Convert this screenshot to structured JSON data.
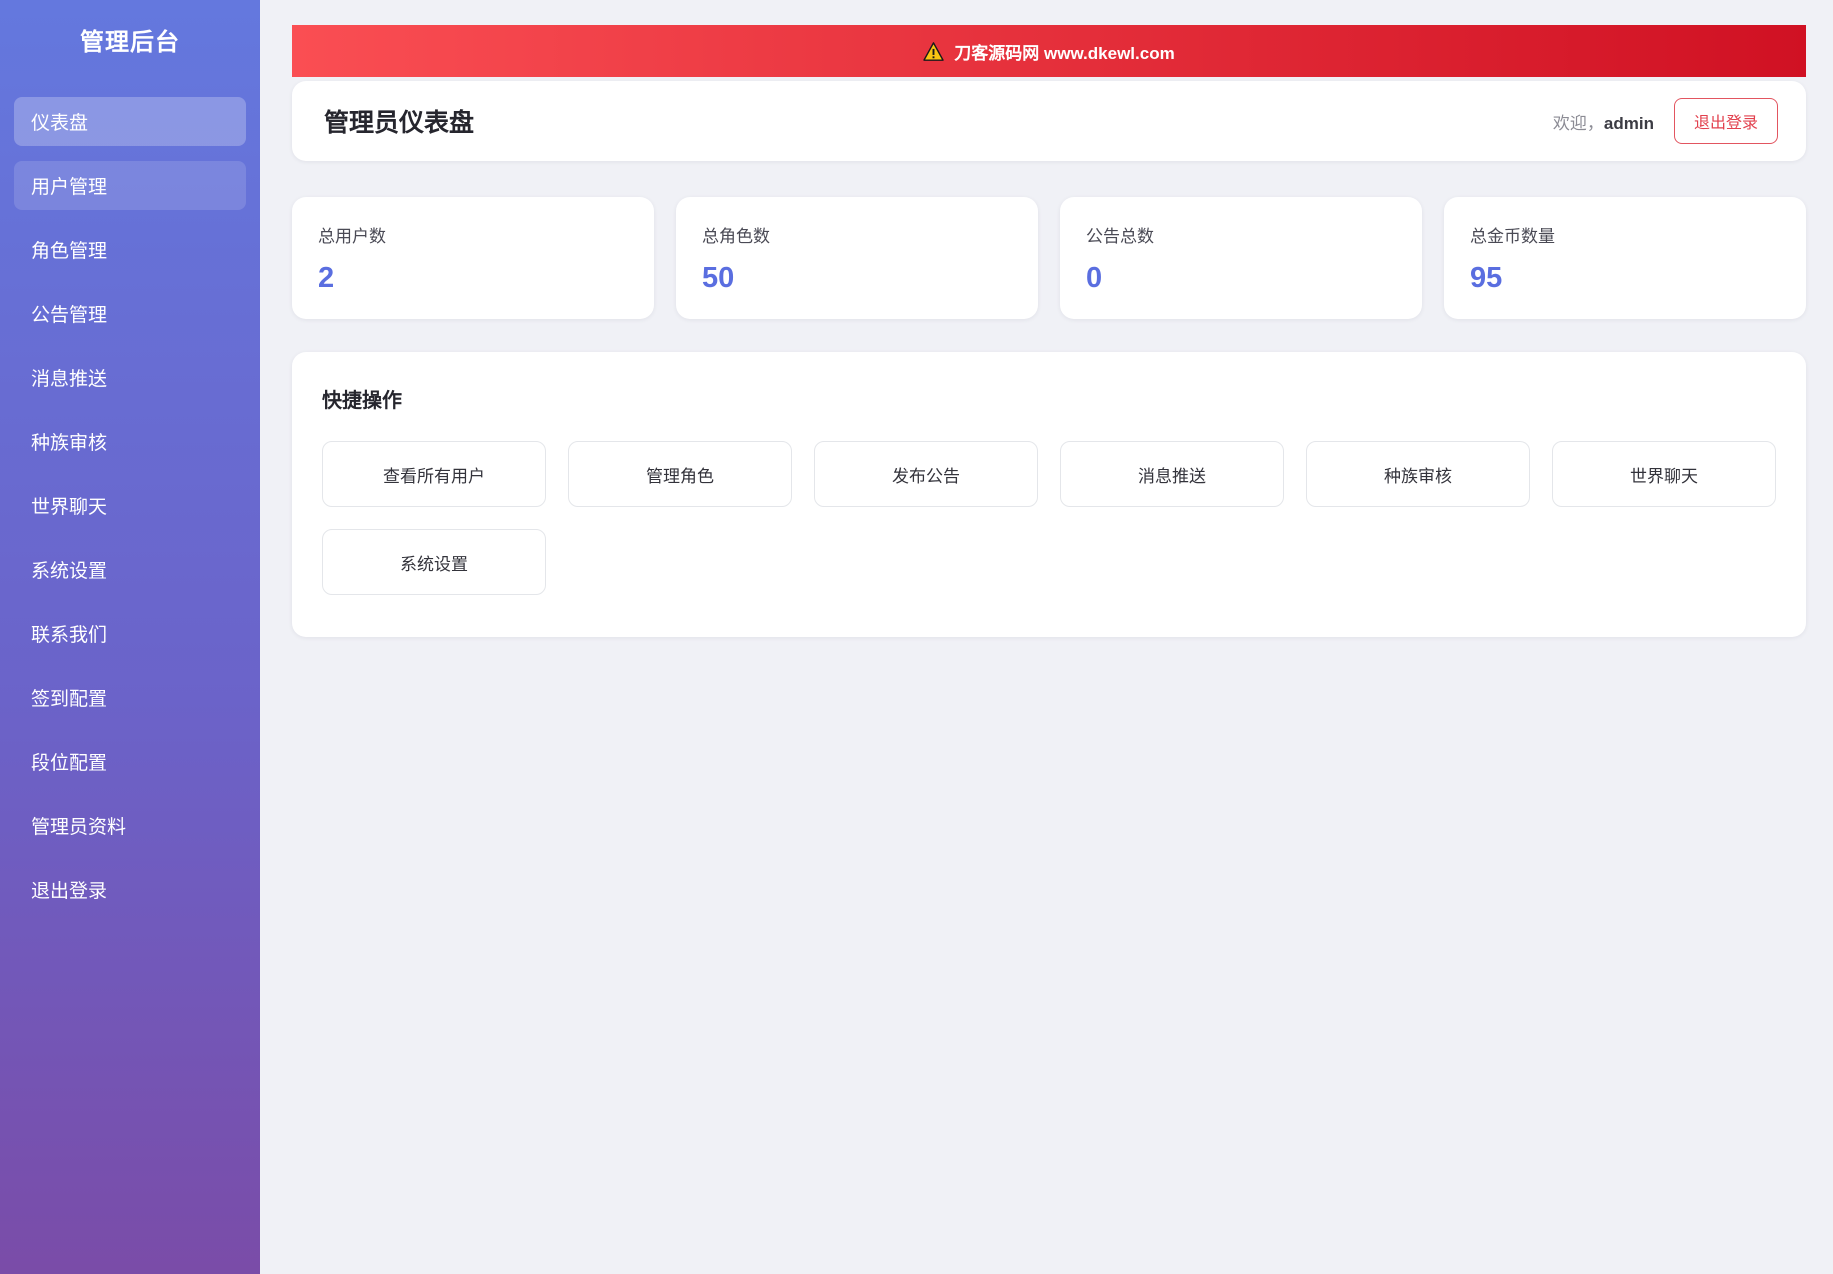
{
  "sidebar": {
    "title": "管理后台",
    "items": [
      {
        "label": "仪表盘",
        "state": "active"
      },
      {
        "label": "用户管理",
        "state": "hover"
      },
      {
        "label": "角色管理",
        "state": "normal"
      },
      {
        "label": "公告管理",
        "state": "normal"
      },
      {
        "label": "消息推送",
        "state": "normal"
      },
      {
        "label": "种族审核",
        "state": "normal"
      },
      {
        "label": "世界聊天",
        "state": "normal"
      },
      {
        "label": "系统设置",
        "state": "normal"
      },
      {
        "label": "联系我们",
        "state": "normal"
      },
      {
        "label": "签到配置",
        "state": "normal"
      },
      {
        "label": "段位配置",
        "state": "normal"
      },
      {
        "label": "管理员资料",
        "state": "normal"
      },
      {
        "label": "退出登录",
        "state": "normal"
      }
    ]
  },
  "banner": {
    "text": "刀客源码网 www.dkewl.com",
    "icon": "warning-icon"
  },
  "header": {
    "title": "管理员仪表盘",
    "welcome_prefix": "欢迎，",
    "username": "admin",
    "logout_label": "退出登录"
  },
  "stats": [
    {
      "label": "总用户数",
      "value": "2"
    },
    {
      "label": "总角色数",
      "value": "50"
    },
    {
      "label": "公告总数",
      "value": "0"
    },
    {
      "label": "总金币数量",
      "value": "95"
    }
  ],
  "quick_actions": {
    "title": "快捷操作",
    "buttons": [
      "查看所有用户",
      "管理角色",
      "发布公告",
      "消息推送",
      "种族审核",
      "世界聊天",
      "系统设置"
    ]
  },
  "colors": {
    "accent_value": "#5a6ee0",
    "sidebar_top": "#6478de",
    "sidebar_bottom": "#7a4ca8",
    "banner_left": "#fa4e53",
    "banner_right": "#d01123",
    "logout_red": "#e2414e",
    "warning_yellow": "#f9c513"
  }
}
